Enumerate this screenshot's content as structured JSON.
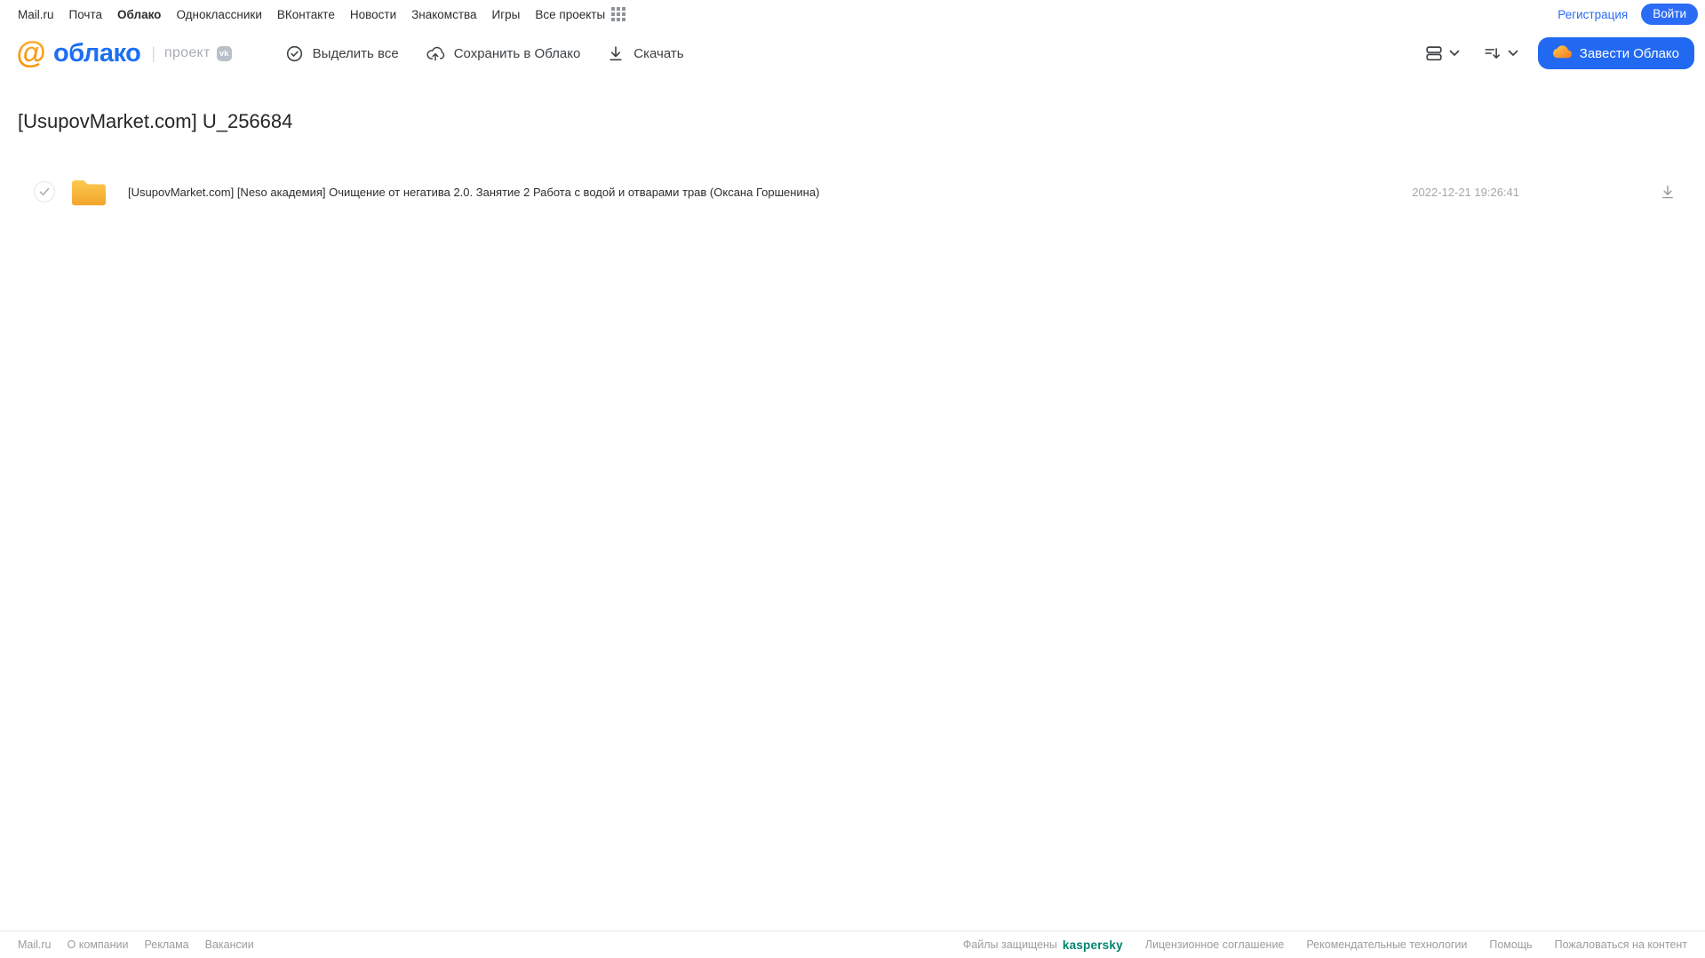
{
  "topnav": {
    "items": [
      "Mail.ru",
      "Почта",
      "Облако",
      "Одноклассники",
      "ВКонтакте",
      "Новости",
      "Знакомства",
      "Игры",
      "Все проекты"
    ],
    "registration": "Регистрация",
    "login": "Войти"
  },
  "header": {
    "logo": "облако",
    "project": "проект",
    "vk": "vk",
    "select_all": "Выделить все",
    "save_to_cloud": "Сохранить в Облако",
    "download": "Скачать",
    "get_cloud": "Завести Облако"
  },
  "main": {
    "title": "[UsupovMarket.com] U_256684",
    "file": {
      "name": "[UsupovMarket.com] [Neso академия] Очищение от негатива 2.0. Занятие 2 Работа с водой и отварами трав (Оксана Горшенина)",
      "date": "2022-12-21 19:26:41"
    }
  },
  "footer": {
    "links_left": [
      "Mail.ru",
      "О компании",
      "Реклама",
      "Вакансии"
    ],
    "protected": "Файлы защищены",
    "kaspersky": "kaspersky",
    "links_right": [
      "Лицензионное соглашение",
      "Рекомендательные технологии",
      "Помощь",
      "Пожаловаться на контент"
    ]
  },
  "colors": {
    "accent_blue": "#2b6cf6",
    "logo_blue": "#1d6ff2",
    "logo_orange": "#f78f00",
    "folder_orange": "#f3a62d",
    "kaspersky_green": "#00846e"
  }
}
